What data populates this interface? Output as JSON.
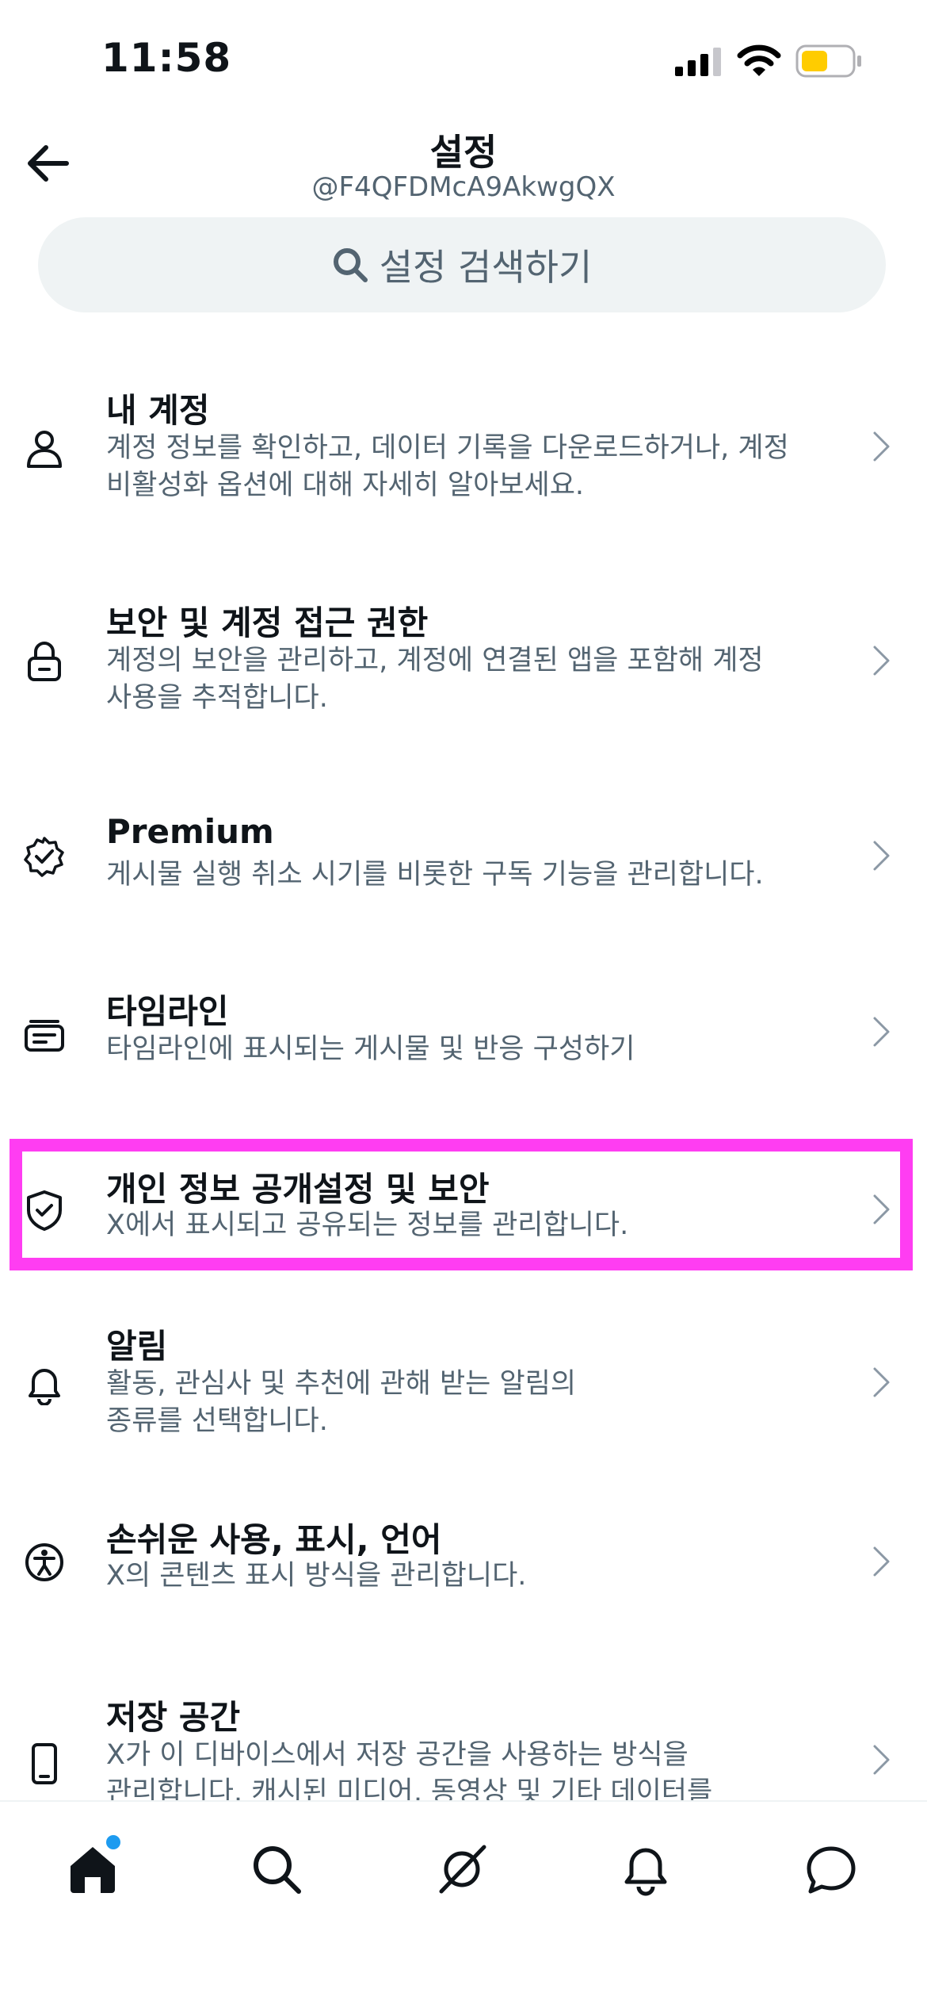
{
  "status_bar": {
    "time": "11:58"
  },
  "header": {
    "title": "설정",
    "username": "@F4QFDMcA9AkwgQX"
  },
  "search": {
    "placeholder": "설정 검색하기"
  },
  "settings": [
    {
      "title": "내 계정",
      "desc_lines": [
        "계정 정보를 확인하고, 데이터 기록을 다운로드하거나, 계정",
        "비활성화 옵션에 대해 자세히 알아보세요."
      ],
      "icon": "person-icon"
    },
    {
      "title": "보안 및 계정 접근 권한",
      "desc_lines": [
        "계정의 보안을 관리하고, 계정에 연결된 앱을 포함해 계정",
        "사용을 추적합니다."
      ],
      "icon": "lock-icon"
    },
    {
      "title": "Premium",
      "desc_lines": [
        "게시물 실행 취소 시기를 비롯한 구독 기능을 관리합니다."
      ],
      "icon": "verified-badge-icon"
    },
    {
      "title": "타임라인",
      "desc_lines": [
        "타임라인에 표시되는 게시물 및 반응 구성하기"
      ],
      "icon": "timeline-card-icon"
    },
    {
      "title": "개인 정보 공개설정 및 보안",
      "desc_lines": [
        "X에서 표시되고 공유되는 정보를 관리합니다."
      ],
      "icon": "shield-icon"
    },
    {
      "title": "알림",
      "desc_lines": [
        "활동, 관심사 및 추천에 관해 받는 알림의",
        "종류를 선택합니다."
      ],
      "icon": "bell-icon"
    },
    {
      "title": "손쉬운 사용, 표시, 언어",
      "desc_lines": [
        "X의 콘텐츠 표시 방식을 관리합니다."
      ],
      "icon": "accessibility-icon"
    },
    {
      "title": "저장 공간",
      "desc_lines": [
        "X가 이 디바이스에서 저장 공간을 사용하는 방식을",
        "관리합니다. 캐시된 미디어, 동영상 및 기타 데이터를"
      ],
      "icon": "phone-icon"
    }
  ],
  "highlight_color": "#ff3df2",
  "accent_color": "#1d9bf0",
  "bottom_nav": [
    "home-icon",
    "search-icon",
    "grok-icon",
    "bell-icon",
    "messages-icon"
  ]
}
